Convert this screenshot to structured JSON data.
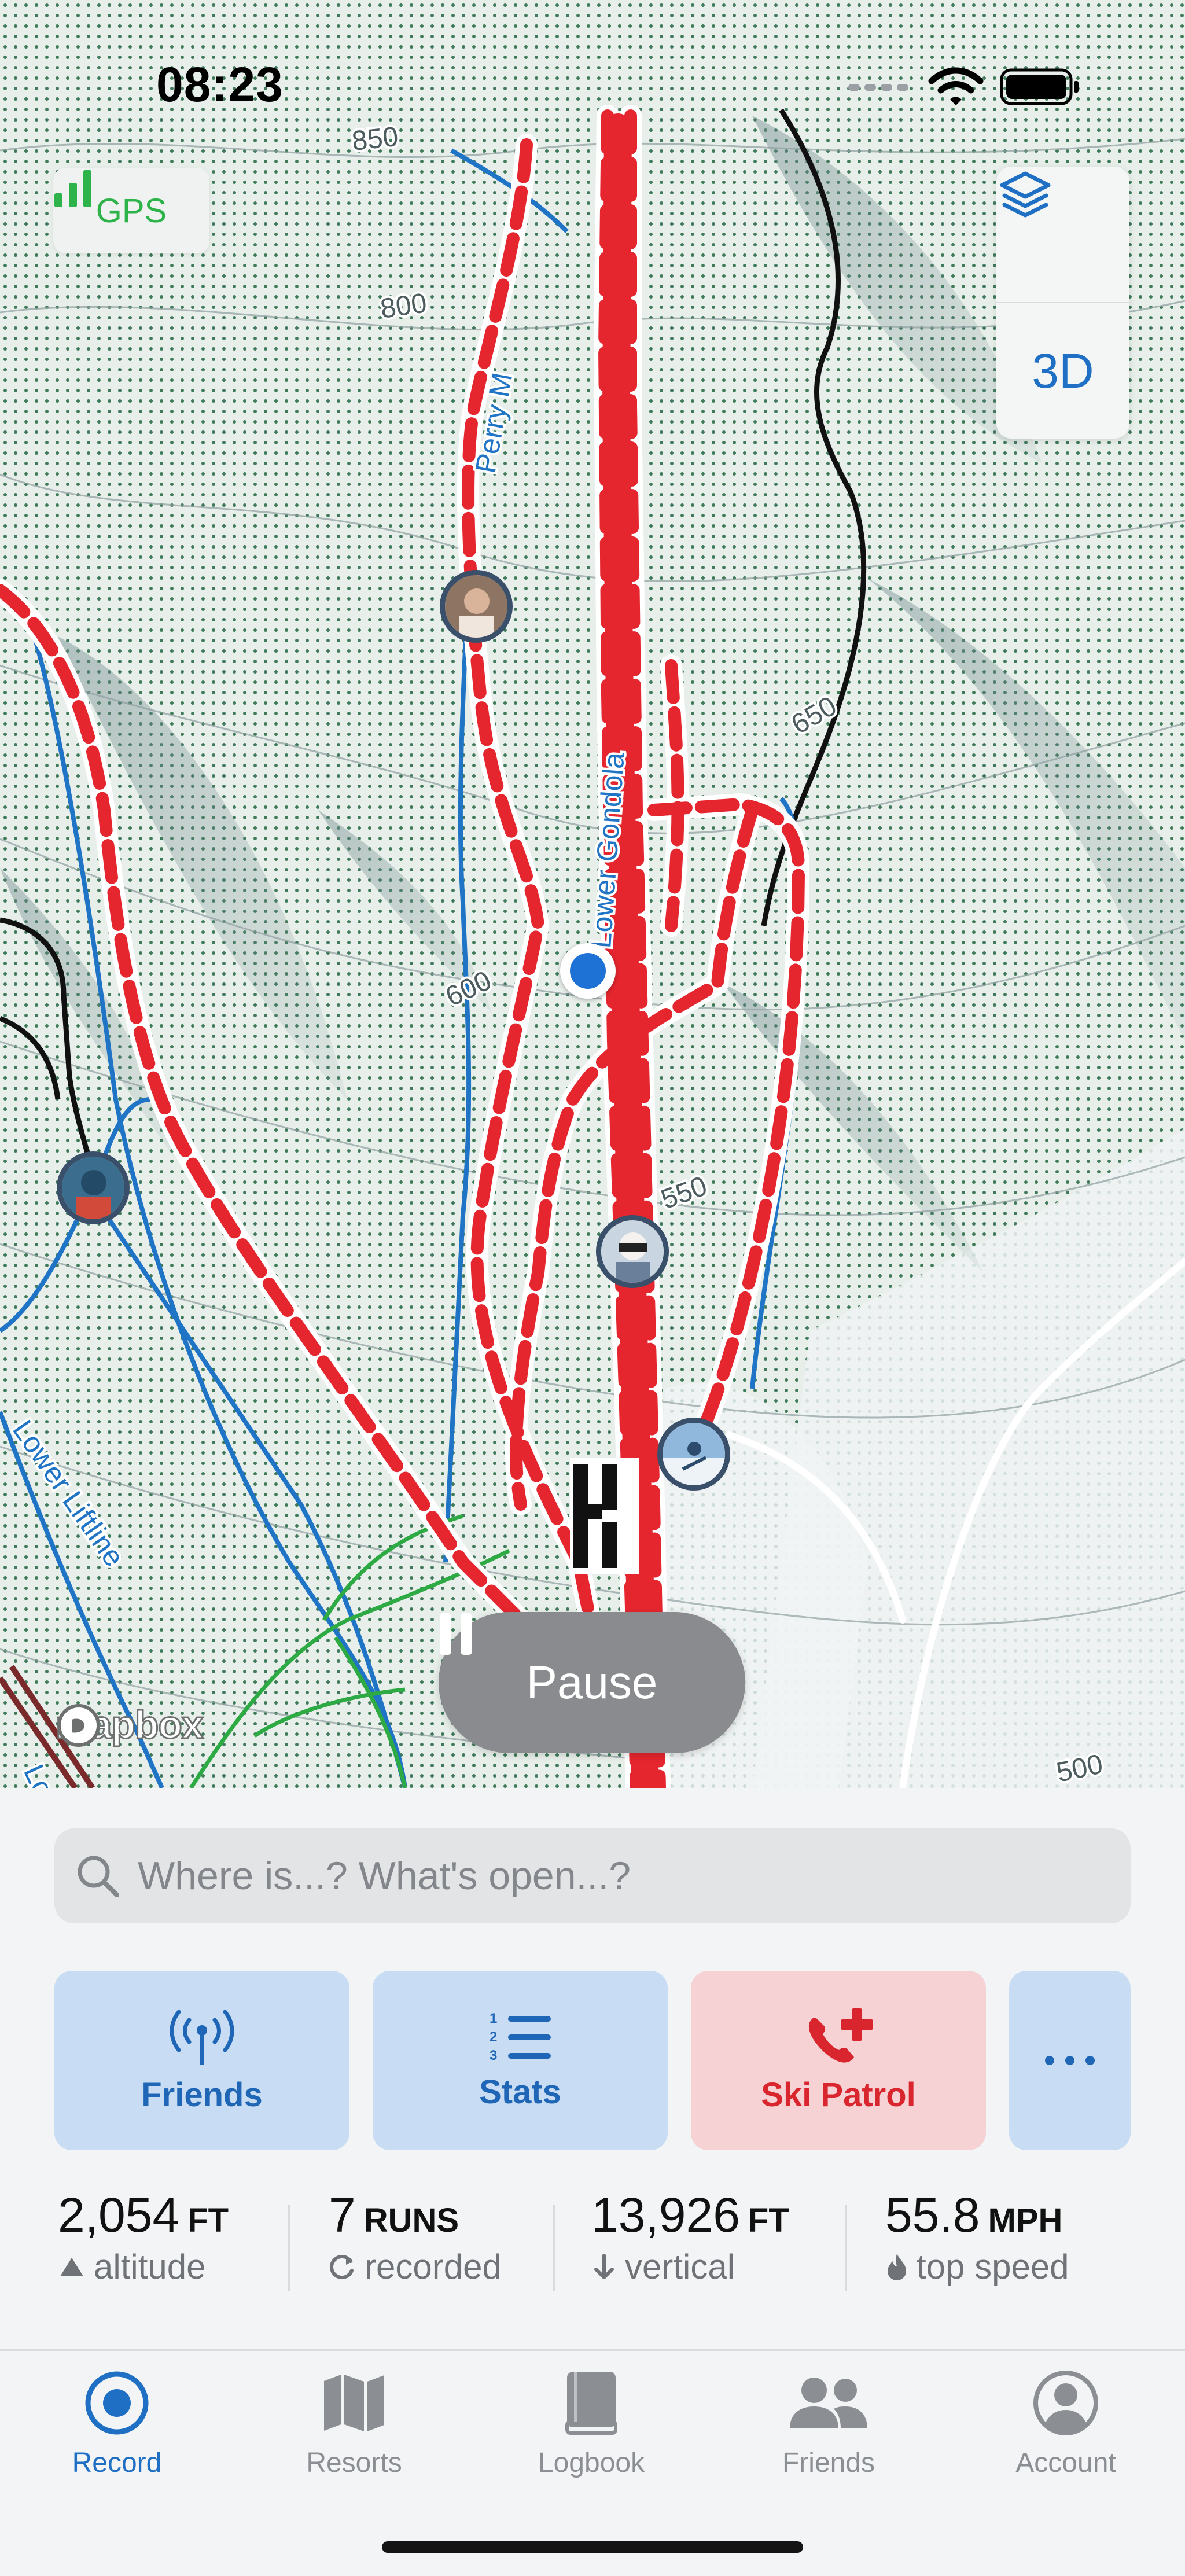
{
  "status_bar": {
    "time": "08:23"
  },
  "map": {
    "gps_label": "GPS",
    "layers_icon": "layers-icon",
    "view_3d_label": "3D",
    "contour_labels": [
      "850",
      "800",
      "650",
      "600",
      "550",
      "500"
    ],
    "trail_labels": [
      "Perry M",
      "Lower Gondola",
      "Lower Liftline",
      "Low"
    ],
    "attribution": "mapbox",
    "pause_label": "Pause"
  },
  "search": {
    "placeholder": "Where is...? What's open...?"
  },
  "actions": [
    {
      "label": "Friends",
      "icon": "broadcast-icon"
    },
    {
      "label": "Stats",
      "icon": "numbered-list-icon"
    },
    {
      "label": "Ski Patrol",
      "icon": "phone-plus-icon"
    },
    {
      "label": "",
      "icon": "more-dots-icon"
    }
  ],
  "stats": [
    {
      "value": "2,054",
      "unit": "FT",
      "label": "altitude",
      "icon": "mountain-icon"
    },
    {
      "value": "7",
      "unit": "RUNS",
      "label": "recorded",
      "icon": "repeat-icon"
    },
    {
      "value": "13,926",
      "unit": "FT",
      "label": "vertical",
      "icon": "arrow-down-icon"
    },
    {
      "value": "55.8",
      "unit": "MPH",
      "label": "top speed",
      "icon": "flame-icon"
    }
  ],
  "tabs": [
    {
      "label": "Record",
      "icon": "record-icon",
      "active": true
    },
    {
      "label": "Resorts",
      "icon": "map-icon",
      "active": false
    },
    {
      "label": "Logbook",
      "icon": "book-icon",
      "active": false
    },
    {
      "label": "Friends",
      "icon": "people-icon",
      "active": false
    },
    {
      "label": "Account",
      "icon": "person-circle-icon",
      "active": false
    }
  ],
  "colors": {
    "accent": "#1f6fc4",
    "track_red": "#e5262f",
    "gps_green": "#2db34a",
    "patrol_bg": "#f6d2d4",
    "action_bg": "#c8dcf3"
  }
}
